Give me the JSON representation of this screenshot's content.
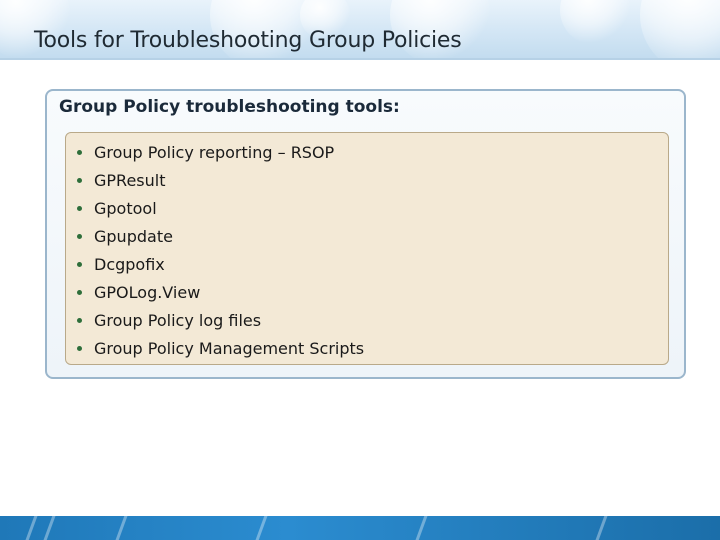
{
  "slide": {
    "title": "Tools for Troubleshooting Group Policies"
  },
  "panel": {
    "heading": "Group Policy troubleshooting tools:",
    "items": [
      "Group Policy reporting – RSOP",
      "GPResult",
      "Gpotool",
      "Gpupdate",
      "Dcgpofix",
      "GPOLog.View",
      "Group Policy log files",
      "Group Policy Management Scripts"
    ]
  },
  "colors": {
    "header": "#d3e6f5",
    "panel_border": "#9bb6cc",
    "inner_box": "#f3e9d6",
    "bullet": "#2e6e3a",
    "footer": "#2b8cd0"
  }
}
